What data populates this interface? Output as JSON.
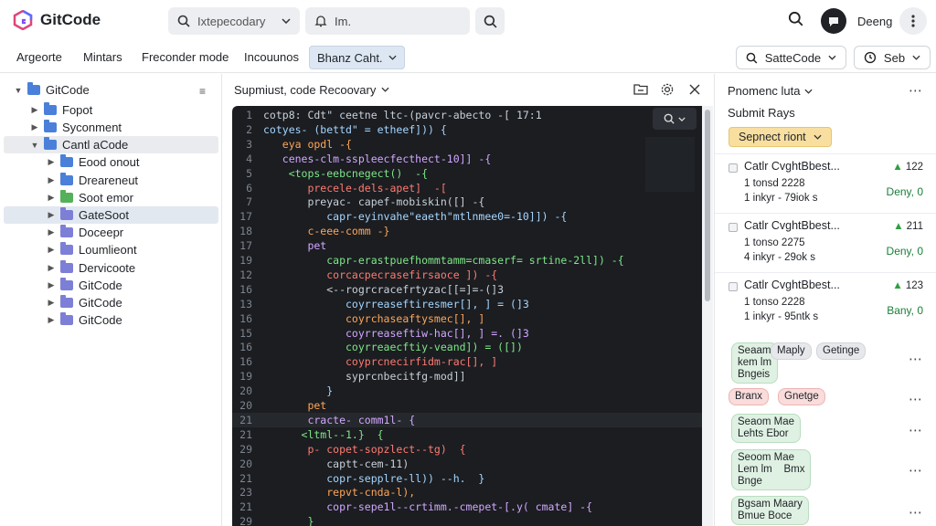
{
  "app": {
    "name": "GitCode",
    "brand_color": "#7c4dff"
  },
  "top": {
    "search_value": "Ixtepecodary",
    "command_value": "Im.",
    "username": "Deeng"
  },
  "menu": {
    "items": [
      "Argeorte",
      "Mintars",
      "Freconder mode",
      "Incouunos"
    ],
    "active": "Bhanz Caht.",
    "right_select": "SatteCode",
    "right_btn": "Seb"
  },
  "sidebar": {
    "items": [
      {
        "label": "GitCode",
        "depth": 0,
        "expanded": true,
        "color": "blue"
      },
      {
        "label": "Fopot",
        "depth": 1,
        "expanded": false,
        "color": "blue"
      },
      {
        "label": "Syconment",
        "depth": 1,
        "expanded": false,
        "color": "blue"
      },
      {
        "label": "Cantl aCode",
        "depth": 1,
        "expanded": true,
        "color": "blue"
      },
      {
        "label": "Eood onout",
        "depth": 2,
        "expanded": false,
        "color": "blue"
      },
      {
        "label": "Dreareneut",
        "depth": 2,
        "expanded": false,
        "color": "blue"
      },
      {
        "label": "Soot emor",
        "depth": 2,
        "expanded": false,
        "color": "green"
      },
      {
        "label": "GateSoot",
        "depth": 2,
        "expanded": false,
        "color": "purple"
      },
      {
        "label": "Doceepr",
        "depth": 2,
        "expanded": false,
        "color": "purple"
      },
      {
        "label": "Loumlieont",
        "depth": 2,
        "expanded": false,
        "color": "purple"
      },
      {
        "label": "Dervicoote",
        "depth": 2,
        "expanded": false,
        "color": "purple"
      },
      {
        "label": "GitCode",
        "depth": 2,
        "expanded": false,
        "color": "purple"
      },
      {
        "label": "GitCode",
        "depth": 2,
        "expanded": false,
        "color": "purple"
      },
      {
        "label": "GitCode",
        "depth": 2,
        "expanded": false,
        "color": "purple"
      }
    ]
  },
  "editor": {
    "title": "Supmiust, code Recoovary",
    "lines": [
      {
        "n": "1",
        "t": "cotp8: Cdt\" ceetne ltc-(pavcr-abecto -[ 17:1"
      },
      {
        "n": "2",
        "t": "cotyes- (bettd\" = etheef])) {"
      },
      {
        "n": "3",
        "t": "   eya opdl -{"
      },
      {
        "n": "4",
        "t": "   cenes-clm-sspleecfecthect-10]] -{"
      },
      {
        "n": "5",
        "t": "    <tops-eebcnegect()  -{"
      },
      {
        "n": "6",
        "t": "       precele-dels-apet]  -["
      },
      {
        "n": "7",
        "t": "       preyac- capef-mobiskin([] -{"
      },
      {
        "n": "17",
        "t": "          capr-eyinvahe\"eaeth\"mtlnmee0=-10]]) -{"
      },
      {
        "n": "18",
        "t": "       c-eee-comm -}"
      },
      {
        "n": "17",
        "t": "       pet"
      },
      {
        "n": "19",
        "t": "          capr-erastpuefhommtamm=cmaserf= srtine-2ll]) -{"
      },
      {
        "n": "12",
        "t": "          corcacpecrasefirsaoce ]) -{"
      },
      {
        "n": "16",
        "t": "          <--rogrcracefrtyzac[[=]=-(]3"
      },
      {
        "n": "13",
        "t": "             coyrreaseftiresmer[], ] = (]3"
      },
      {
        "n": "16",
        "t": "             coyrchaseaftysmec[], ]"
      },
      {
        "n": "15",
        "t": "             coyrreaseftiw-hac[], ] =. (]3"
      },
      {
        "n": "16",
        "t": "             coyrreaecftiy-veand]) = ([])"
      },
      {
        "n": "16",
        "t": "             coyprcnecirfidm-rac[], ]"
      },
      {
        "n": "19",
        "t": "             syprcnbecitfg-mod]]"
      },
      {
        "n": "20",
        "t": "          }"
      },
      {
        "n": "20",
        "t": "       pet"
      },
      {
        "n": "21",
        "t": "       cracte- comm1l- {"
      },
      {
        "n": "21",
        "t": "      <ltml--1.}  {"
      },
      {
        "n": "29",
        "t": "       p- copet-sopzlect--tg)  {"
      },
      {
        "n": "20",
        "t": "          captt-cem-11)"
      },
      {
        "n": "21",
        "t": "          copr-sepplre-ll)) --h.  }"
      },
      {
        "n": "23",
        "t": "          repvt-cnda-l),      "
      },
      {
        "n": "21",
        "t": "          copr-sepe1l--crtimm.-cmepet-[.y( cmate] -{"
      },
      {
        "n": "29",
        "t": "       }"
      }
    ]
  },
  "right": {
    "title": "Pnomenc luta",
    "subtitle": "Submit Rays",
    "pill": "Sepnect riont",
    "cards": [
      {
        "title": "Catlr CvghtBbest...",
        "line2": "1 tonsd 2228",
        "line3": "1 inkyr - 79iok s",
        "count": "122",
        "status": "Deny, 0"
      },
      {
        "title": "Catlr CvghtBbest...",
        "line2": "1 tonso 2275",
        "line3": "4 inkyr - 29ok s",
        "count": "211",
        "status": "Deny, 0"
      },
      {
        "title": "Catlr CvghtBbest...",
        "line2": "1 tonso 2228",
        "line3": "1 inkyr - 95ntk s",
        "count": "123",
        "status": "Bany, 0"
      }
    ],
    "tag_groups": [
      {
        "tags": [
          "Seaam\nkem lm\nBngeis",
          "Maply",
          "Getinge"
        ]
      },
      {
        "tags": [
          "Branx",
          "Gnetge"
        ]
      },
      {
        "tags": [
          "Seaom Mae\nLehts Ebor"
        ]
      },
      {
        "tags": [
          "Seoom Mae\nLem lm    Bmx\nBnge"
        ]
      },
      {
        "tags": [
          "Bgsam Maary\nBmue Boce"
        ]
      }
    ]
  }
}
